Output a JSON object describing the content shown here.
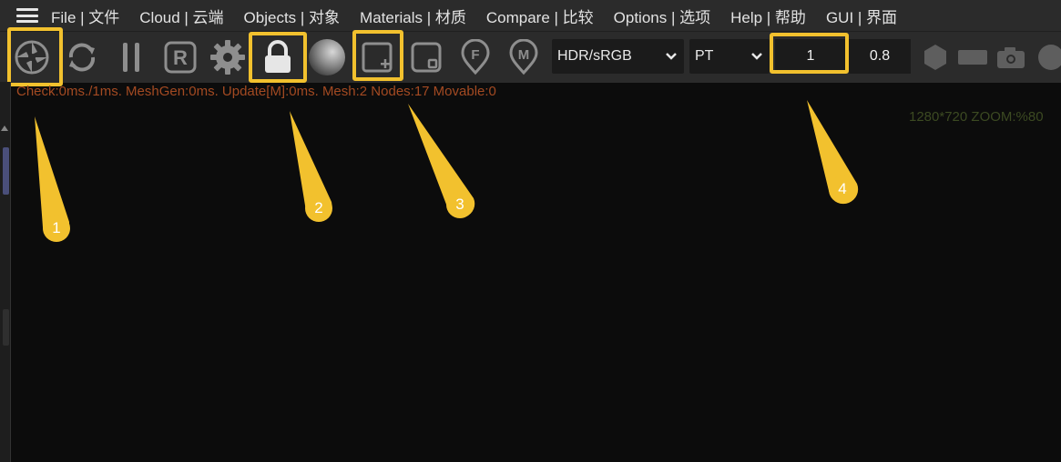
{
  "menu": {
    "items": [
      {
        "label": "File | 文件"
      },
      {
        "label": "Cloud | 云端"
      },
      {
        "label": "Objects | 对象"
      },
      {
        "label": "Materials | 材质"
      },
      {
        "label": "Compare | 比较"
      },
      {
        "label": "Options | 选项"
      },
      {
        "label": "Help | 帮助"
      },
      {
        "label": "GUI | 界面"
      }
    ]
  },
  "toolbar": {
    "icons": [
      "render-shutter-icon",
      "refresh-icon",
      "pause-icon",
      "r-badge-icon",
      "gear-icon",
      "lock-icon",
      "sphere-icon",
      "add-frame-icon",
      "frame-icon",
      "f-pin-icon",
      "m-pin-icon"
    ],
    "tonemap_select": "HDR/sRGB",
    "mode_select": "PT",
    "value_primary": "1",
    "value_secondary": "0.8",
    "right_icons": [
      "hexagon-icon",
      "rectangle-icon",
      "camera-icon",
      "circle-icon"
    ]
  },
  "viewport": {
    "status": "Check:0ms./1ms. MeshGen:0ms. Update[M]:0ms. Mesh:2 Nodes:17 Movable:0",
    "resolution": "1280*720 ZOOM:%80"
  },
  "callouts": [
    "1",
    "2",
    "3",
    "4"
  ],
  "colors": {
    "highlight": "#f2c12e",
    "status_text": "#a34a22",
    "resolution_text": "#3c4a22",
    "toolbar_bg": "#2b2b2b",
    "viewport_bg": "#0c0c0c"
  }
}
